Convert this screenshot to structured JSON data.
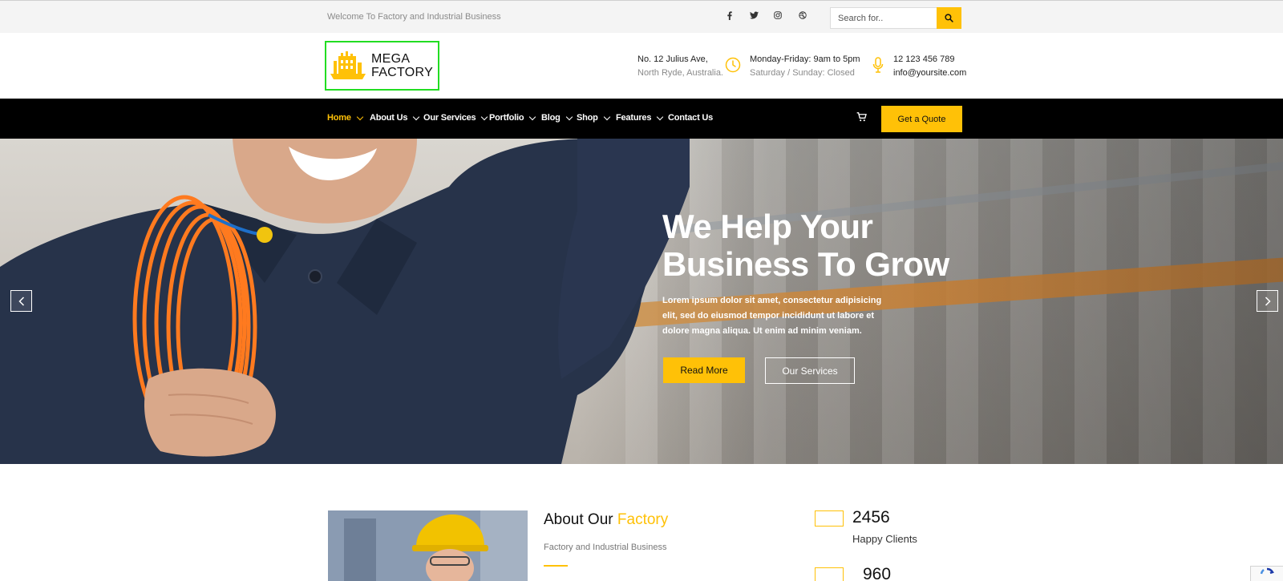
{
  "topbar": {
    "welcome": "Welcome To Factory and Industrial Business",
    "social_icons": [
      "facebook-icon",
      "twitter-icon",
      "instagram-icon",
      "dribbble-icon"
    ],
    "search_placeholder": "Search for.."
  },
  "header": {
    "logo": {
      "line1": "MEGA",
      "line2": "FACTORY"
    },
    "address": {
      "line1": "No. 12 Julius Ave,",
      "line2": "North Ryde, Australia."
    },
    "hours": {
      "line1": "Monday-Friday: 9am to 5pm",
      "line2": "Saturday / Sunday: Closed"
    },
    "contact": {
      "line1": "12 123 456 789",
      "line2": "info@yoursite.com"
    }
  },
  "nav": {
    "items": [
      {
        "label": "Home",
        "active": true
      },
      {
        "label": "About Us"
      },
      {
        "label": "Our Services"
      },
      {
        "label": "Portfolio"
      },
      {
        "label": "Blog"
      },
      {
        "label": "Shop"
      },
      {
        "label": "Features"
      },
      {
        "label": "Contact Us"
      }
    ],
    "quote_label": "Get a Quote"
  },
  "hero": {
    "title_line1": "We Help Your",
    "title_line2": "Business To Grow",
    "text": "Lorem ipsum dolor sit amet, consectetur adipisicing elit, sed do eiusmod tempor incididunt ut labore et dolore magna aliqua. Ut enim ad minim veniam.",
    "read_more": "Read More",
    "our_services": "Our Services"
  },
  "about": {
    "title_prefix": "About Our",
    "title_highlight": "Factory",
    "subtitle": "Factory and Industrial Business"
  },
  "stats": [
    {
      "value": "2456",
      "label": "Happy Clients"
    },
    {
      "value": "960"
    }
  ],
  "colors": {
    "accent": "#ffc107",
    "nav_bg": "#000000",
    "logo_border": "#22dd22"
  }
}
